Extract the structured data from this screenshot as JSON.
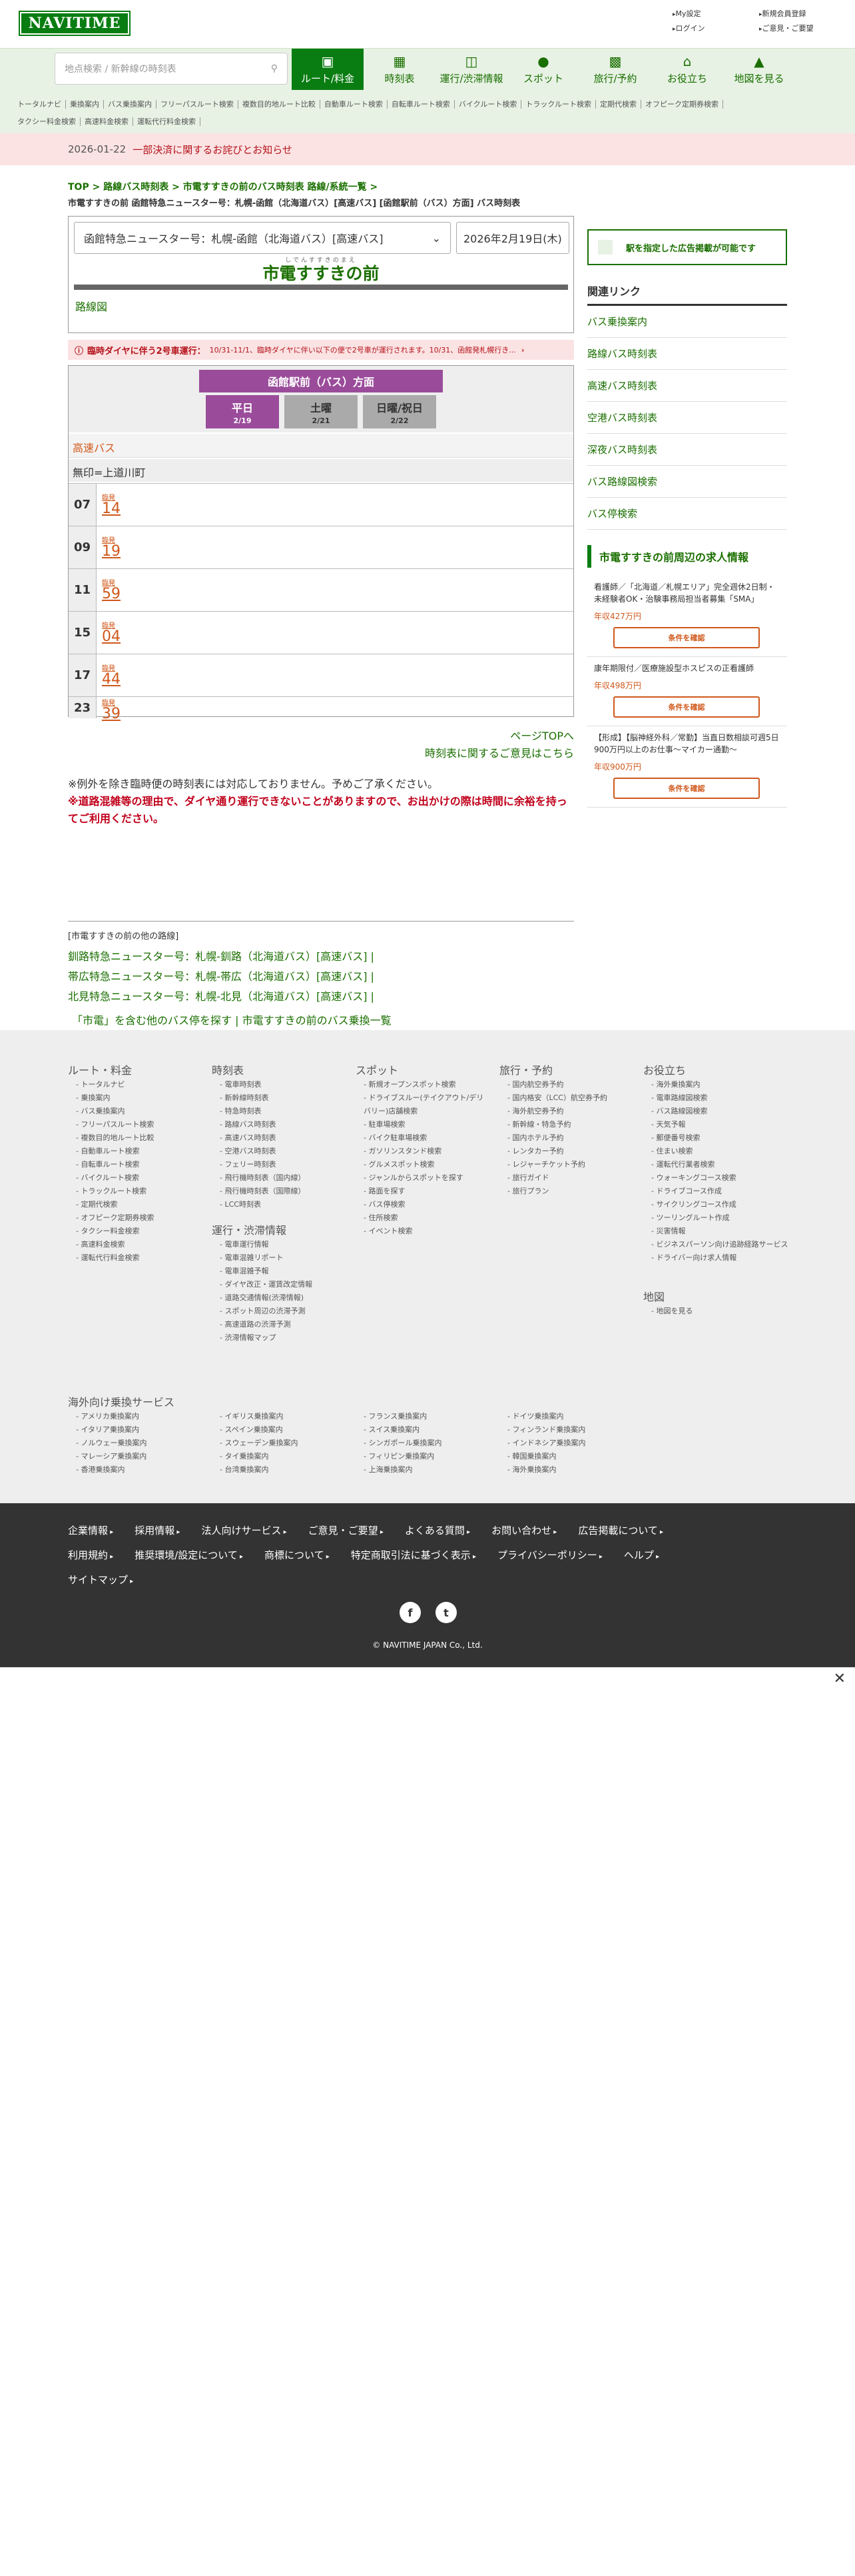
{
  "header": {
    "logo": "NAVITIME",
    "links": [
      "My設定",
      "新規会員登録",
      "ログイン",
      "ご意見・ご要望"
    ]
  },
  "nav": {
    "search_placeholder": "地点検索 / 新幹線の時刻表",
    "items": [
      {
        "label": "ルート/料金",
        "icon": "cube-icon"
      },
      {
        "label": "時刻表",
        "icon": "calendar-icon"
      },
      {
        "label": "運行/渋滞情報",
        "icon": "train-icon"
      },
      {
        "label": "スポット",
        "icon": "pin-icon"
      },
      {
        "label": "旅行/予約",
        "icon": "suitcase-icon"
      },
      {
        "label": "お役立ち",
        "icon": "house-icon"
      },
      {
        "label": "地図を見る",
        "icon": "map-icon"
      }
    ]
  },
  "sublinks": [
    "トータルナビ",
    "乗換案内",
    "バス乗換案内",
    "フリーパスルート検索",
    "複数目的地ルート比較",
    "自動車ルート検索",
    "自転車ルート検索",
    "バイクルート検索",
    "トラックルート検索",
    "定期代検索",
    "オフピーク定期券検索",
    "タクシー料金検索",
    "高速料金検索",
    "運転代行料金検索"
  ],
  "notice": {
    "date": "2026-01-22",
    "text": "一部決済に関するお詫びとお知らせ"
  },
  "breadcrumb": {
    "top": "TOP",
    "b1": "路線バス時刻表",
    "b2": "市電すすきの前のバス時刻表 路線/系統一覧",
    "sep": " > "
  },
  "subtitle": "市電すすきの前 函館特急ニュースター号：札幌-函館（北海道バス）[高速バス] [函館駅前（バス）方面] バス時刻表",
  "selector": {
    "route": "函館特急ニュースター号：札幌-函館（北海道バス）[高速バス]",
    "date": "2026年2月19日(木)"
  },
  "station": {
    "ruby": "しでんすすきのまえ",
    "name": "市電すすきの前",
    "route_map": "路線図"
  },
  "alert": {
    "title": "臨時ダイヤに伴う2号車運行：",
    "text": "10/31-11/1、臨時ダイヤに伴い以下の便で2号車が運行されます。10/31、函館発札幌行き..."
  },
  "timetable": {
    "direction": "函館駅前（バス）方面",
    "days": [
      {
        "label": "平日",
        "date": "2/19"
      },
      {
        "label": "土曜",
        "date": "2/21"
      },
      {
        "label": "日曜/祝日",
        "date": "2/22"
      }
    ],
    "kind": "高速バス",
    "legend": "無印=上道川町",
    "rows": [
      {
        "hour": "07",
        "min": "14",
        "tag": "臨発"
      },
      {
        "hour": "09",
        "min": "19",
        "tag": "臨発"
      },
      {
        "hour": "11",
        "min": "59",
        "tag": "臨発"
      },
      {
        "hour": "15",
        "min": "04",
        "tag": "臨発"
      },
      {
        "hour": "17",
        "min": "44",
        "tag": "臨発"
      },
      {
        "hour": "23",
        "min": "39",
        "tag": "臨発"
      }
    ]
  },
  "links": {
    "pagetop": "ページTOPへ",
    "opinion": "時刻表に関するご意見はこちら"
  },
  "warn": {
    "line1": "※例外を除き臨時便の時刻表には対応しておりません。予めご了承ください。",
    "line2": "※道路混雑等の理由で、ダイヤ通り運行できないことがありますので、お出かけの際は時間に余裕を持ってご利用ください。"
  },
  "others": {
    "label": "[市電すすきの前の他の路線]",
    "routes": [
      "釧路特急ニュースター号：札幌-釧路（北海道バス）[高速バス]",
      "帯広特急ニュースター号：札幌-帯広（北海道バス）[高速バス]",
      "北見特急ニュースター号：札幌-北見（北海道バス）[高速バス]"
    ],
    "link1": "「市電」を含む他のバス停を探す",
    "link2": "市電すすきの前のバス乗換一覧"
  },
  "side": {
    "ad": "駅を指定した広告掲載が可能です",
    "related_title": "関連リンク",
    "related": [
      "バス乗換案内",
      "路線バス時刻表",
      "高速バス時刻表",
      "空港バス時刻表",
      "深夜バス時刻表",
      "バス路線図検索",
      "バス停検索"
    ],
    "jobs_title": "市電すすきの前周辺の求人情報",
    "jobs": [
      {
        "desc": "看護師／「北海道／札幌エリア」完全週休2日制・未経験者OK・治験事務局担当者募集「SMA」",
        "salary": "年収427万円",
        "btn": "条件を確認"
      },
      {
        "desc": "康年期限付／医療施設型ホスピスの正看護師",
        "salary": "年収498万円",
        "btn": "条件を確認"
      },
      {
        "desc": "【形成】【脳神経外科／常勤】当直日数相談可週5日900万円以上のお仕事〜マイカー通勤〜",
        "salary": "年収900万円",
        "btn": "条件を確認"
      }
    ]
  },
  "footer": {
    "cols": [
      {
        "title": "ルート・料金",
        "items": [
          "トータルナビ",
          "乗換案内",
          "バス乗換案内",
          "フリーパスルート検索",
          "複数目的地ルート比較",
          "自動車ルート検索",
          "自転車ルート検索",
          "バイクルート検索",
          "トラックルート検索",
          "定期代検索",
          "オフピーク定期券検索",
          "タクシー料金検索",
          "高速料金検索",
          "運転代行料金検索"
        ]
      },
      {
        "title": "時刻表",
        "items": [
          "電車時刻表",
          "新幹線時刻表",
          "特急時刻表",
          "路線バス時刻表",
          "高速バス時刻表",
          "空港バス時刻表",
          "フェリー時刻表",
          "飛行機時刻表（国内線）",
          "飛行機時刻表（国際線）",
          "LCC時刻表"
        ]
      },
      {
        "title": "運行・渋滞情報",
        "items": [
          "電車運行情報",
          "電車混雑リポート",
          "電車混雑予報",
          "ダイヤ改正・運賃改定情報",
          "道路交通情報(渋滞情報)",
          "スポット周辺の渋滞予測",
          "高速道路の渋滞予測",
          "渋滞情報マップ"
        ]
      },
      {
        "title": "スポット",
        "items": [
          "新規オープンスポット検索",
          "ドライブスルー(テイクアウト/デリバリー)店舗検索",
          "駐車場検索",
          "バイク駐車場検索",
          "ガソリンスタンド検索",
          "グルメスポット検索",
          "ジャンルからスポットを探す",
          "路面を探す",
          "バス停検索",
          "住所検索",
          "イベント検索"
        ]
      },
      {
        "title": "旅行・予約",
        "items": [
          "国内航空券予約",
          "国内格安（LCC）航空券予約",
          "海外航空券予約",
          "新幹線・特急予約",
          "国内ホテル予約",
          "レンタカー予約",
          "レジャーチケット予約",
          "旅行ガイド",
          "旅行プラン"
        ]
      },
      {
        "title": "お役立ち",
        "items": [
          "海外乗換案内",
          "電車路線図検索",
          "バス路線図検索",
          "天気予報",
          "郵便番号検索",
          "住まい検索",
          "運転代行業者検索",
          "ウォーキングコース検索",
          "ドライブコース作成",
          "サイクリングコース作成",
          "ツーリングルート作成",
          "災害情報",
          "ビジネスパーソン向け追跡経路サービス",
          "ドライバー向け求人情報"
        ]
      },
      {
        "title": "地図",
        "items": [
          "地図を見る"
        ]
      }
    ],
    "overseas_title": "海外向け乗換サービス",
    "overseas": [
      "アメリカ乗換案内",
      "イタリア乗換案内",
      "ノルウェー乗換案内",
      "マレーシア乗換案内",
      "香港乗換案内",
      "イギリス乗換案内",
      "スペイン乗換案内",
      "スウェーデン乗換案内",
      "タイ乗換案内",
      "台湾乗換案内",
      "フランス乗換案内",
      "スイス乗換案内",
      "シンガポール乗換案内",
      "フィリピン乗換案内",
      "上海乗換案内",
      "ドイツ乗換案内",
      "フィンランド乗換案内",
      "インドネシア乗換案内",
      "韓国乗換案内",
      "海外乗換案内"
    ]
  },
  "bottom": {
    "links": [
      "企業情報",
      "採用情報",
      "法人向けサービス",
      "ご意見・ご要望",
      "よくある質問",
      "お問い合わせ",
      "広告掲載について",
      "利用規約",
      "推奨環境/設定について",
      "商標について",
      "特定商取引法に基づく表示",
      "プライバシーポリシー",
      "ヘルプ",
      "サイトマップ"
    ],
    "copyright": "© NAVITIME JAPAN Co., Ltd."
  }
}
